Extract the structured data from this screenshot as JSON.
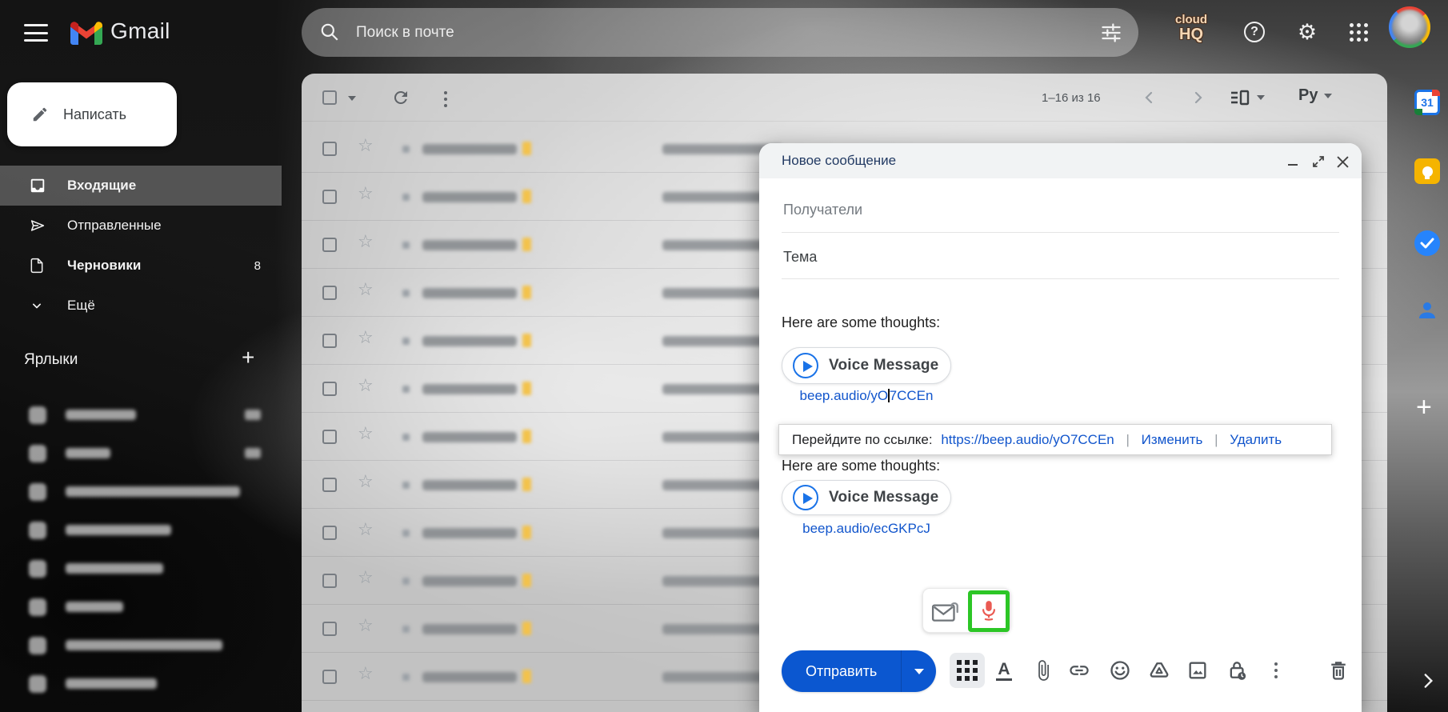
{
  "topbar": {
    "brand": "Gmail",
    "search_placeholder": "Поиск в почте",
    "cloudhq": {
      "line1": "cloud",
      "line2": "HQ"
    }
  },
  "icons": {
    "gear": "⚙",
    "help": "?",
    "star": "☆",
    "calendar_day": "31",
    "plus_label": "+",
    "format_letter": "A",
    "language": "Ру"
  },
  "sidebar": {
    "compose_label": "Написать",
    "items": [
      {
        "label": "Входящие"
      },
      {
        "label": "Отправленные"
      },
      {
        "label": "Черновики",
        "count": "8"
      },
      {
        "label": "Ещё"
      }
    ],
    "labels_header": "Ярлыки"
  },
  "list": {
    "pagination": "1–16 из 16"
  },
  "compose": {
    "title": "Новое сообщение",
    "recipients_placeholder": "Получатели",
    "subject_placeholder": "Тема",
    "body": {
      "para1": "Here are some thoughts:",
      "voice1_label": "Voice Message",
      "voice1_link_before_cursor": "beep.audio/yO",
      "voice1_link_after_cursor": "7CCEn",
      "para2": "Here are some thoughts:",
      "voice2_label": "Voice Message",
      "voice2_link": "beep.audio/ecGKPcJ"
    },
    "tooltip": {
      "prefix": "Перейдите по ссылке:",
      "url": "https://beep.audio/yO7CCEn",
      "sep": "|",
      "edit": "Изменить",
      "delete": "Удалить"
    },
    "send_label": "Отправить"
  },
  "colors": {
    "send_button": "#0b57d0",
    "link": "#1155cc",
    "mic_red": "#ea5a52",
    "highlight_green": "#2cc626",
    "play_blue": "#1a73e8",
    "compose_title": "#223a63"
  }
}
